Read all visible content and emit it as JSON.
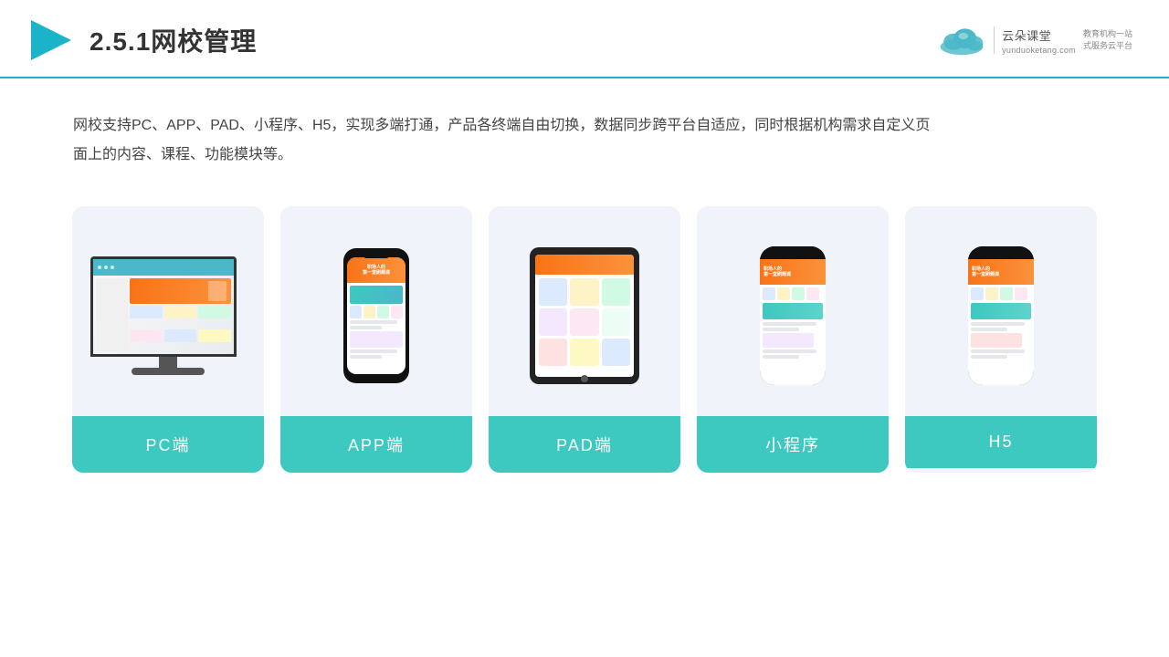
{
  "header": {
    "title": "2.5.1网校管理",
    "logo_name": "云朵课堂",
    "logo_url": "yunduoketang.com",
    "logo_tagline1": "教育机构一站",
    "logo_tagline2": "式服务云平台"
  },
  "description": {
    "text": "网校支持PC、APP、PAD、小程序、H5，实现多端打通，产品各终端自由切换，数据同步跨平台自适应，同时根据机构需求自定义页面上的内容、课程、功能模块等。"
  },
  "cards": [
    {
      "id": "pc",
      "label": "PC端"
    },
    {
      "id": "app",
      "label": "APP端"
    },
    {
      "id": "pad",
      "label": "PAD端"
    },
    {
      "id": "miniprogram",
      "label": "小程序"
    },
    {
      "id": "h5",
      "label": "H5"
    }
  ]
}
